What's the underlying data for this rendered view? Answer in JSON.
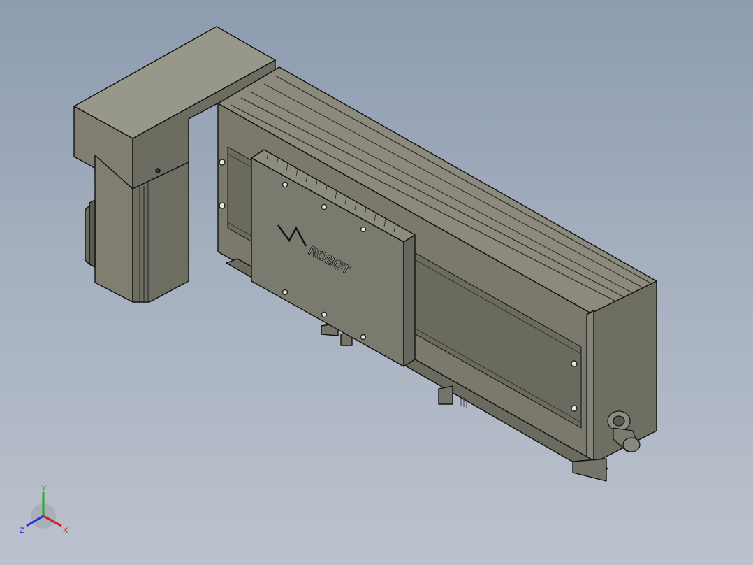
{
  "model": {
    "brand_logo_text": "ROBOT"
  },
  "triad": {
    "x_label": "X",
    "y_label": "Y",
    "z_label": "Z",
    "x_color": "#d42020",
    "y_color": "#1fb02a",
    "z_color": "#2233dd"
  },
  "colors": {
    "body_top": "#8f8f81",
    "body_front": "#7d7c6f",
    "body_side": "#696a5e",
    "outline": "#111111"
  }
}
